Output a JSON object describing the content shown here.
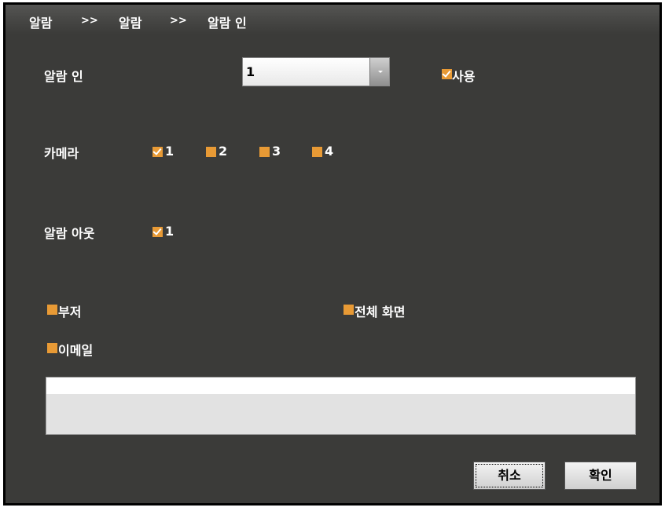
{
  "breadcrumb": {
    "items": [
      "알람",
      "알람",
      "알람 인"
    ],
    "separator": ">>"
  },
  "alarm_in": {
    "label": "알람 인",
    "selected": "1",
    "enable_label": "사용",
    "enable_checked": true
  },
  "camera": {
    "label": "카메라",
    "items": [
      {
        "label": "1",
        "checked": true
      },
      {
        "label": "2",
        "checked": false
      },
      {
        "label": "3",
        "checked": false
      },
      {
        "label": "4",
        "checked": false
      }
    ]
  },
  "alarm_out": {
    "label": "알람 아웃",
    "items": [
      {
        "label": "1",
        "checked": true
      }
    ]
  },
  "options": {
    "buzzer": "부저",
    "fullscreen": "전체 화면",
    "email": "이메일"
  },
  "buttons": {
    "cancel": "취소",
    "ok": "확인"
  },
  "colors": {
    "panel_bg": "#3b3b39",
    "checkbox": "#e89a35",
    "text": "#ffffff"
  }
}
